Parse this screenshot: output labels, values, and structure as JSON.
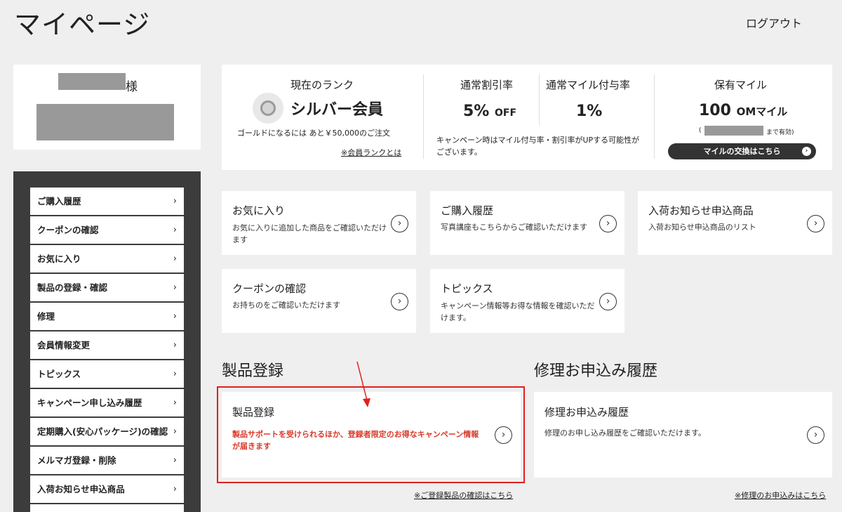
{
  "header": {
    "title": "マイページ",
    "logout": "ログアウト"
  },
  "user": {
    "suffix": "様"
  },
  "sidebar": {
    "items": [
      {
        "label": "ご購入履歴"
      },
      {
        "label": "クーポンの確認"
      },
      {
        "label": "お気に入り"
      },
      {
        "label": "製品の登録・確認"
      },
      {
        "label": "修理"
      },
      {
        "label": "会員情報変更"
      },
      {
        "label": "トピックス"
      },
      {
        "label": "キャンペーン申し込み履歴"
      },
      {
        "label": "定期購入(安心パッケージ)の確認"
      },
      {
        "label": "メルマガ登録・削除"
      },
      {
        "label": "入荷お知らせ申込商品"
      }
    ],
    "chevron": "›"
  },
  "rank": {
    "heading": "現在のランク",
    "name": "シルバー会員",
    "next": "ゴールドになるには あと￥50,000のご注文",
    "link": "※会員ランクとは",
    "medal_label": "silver",
    "discount_heading": "通常割引率",
    "discount_value": "5%",
    "discount_unit": "OFF",
    "mile_rate_heading": "通常マイル付与率",
    "mile_rate_value": "1%",
    "campaign_note": "キャンペーン時はマイル付与率・割引率がUPする可能性がございます。",
    "miles_heading": "保有マイル",
    "miles_value": "100",
    "miles_unit": "OMマイル",
    "expiry_prefix": "(",
    "expiry_suffix": "まで有効)",
    "exchange_button": "マイルの交換はこちら"
  },
  "cards": [
    {
      "title": "お気に入り",
      "desc": "お気に入りに追加した商品をご確認いただけます"
    },
    {
      "title": "ご購入履歴",
      "desc": "写真講座もこちらからご確認いただけます"
    },
    {
      "title": "入荷お知らせ申込商品",
      "desc": "入荷お知らせ申込商品のリスト"
    },
    {
      "title": "クーポンの確認",
      "desc": "お持ちのをご確認いただけます"
    },
    {
      "title": "トピックス",
      "desc": "キャンペーン情報等お得な情報を確認いただけます。"
    }
  ],
  "product_registration": {
    "section_title": "製品登録",
    "card_title": "製品登録",
    "card_desc": "製品サポートを受けられるほか、登録者限定のお得なキャンペーン情報が届きます",
    "footer_link": "※ご登録製品の確認はこちら"
  },
  "repair_history": {
    "section_title": "修理お申込み履歴",
    "card_title": "修理お申込み履歴",
    "card_desc": "修理のお申し込み履歴をご確認いただけます。",
    "footer_link": "※修理のお申込みはこちら"
  },
  "icons": {
    "circle_arrow": "›",
    "button_dot": "›"
  },
  "colors": {
    "highlight": "#e02020",
    "promo_text": "#d83a2a",
    "sidebar_bg": "#3c3c3c"
  }
}
